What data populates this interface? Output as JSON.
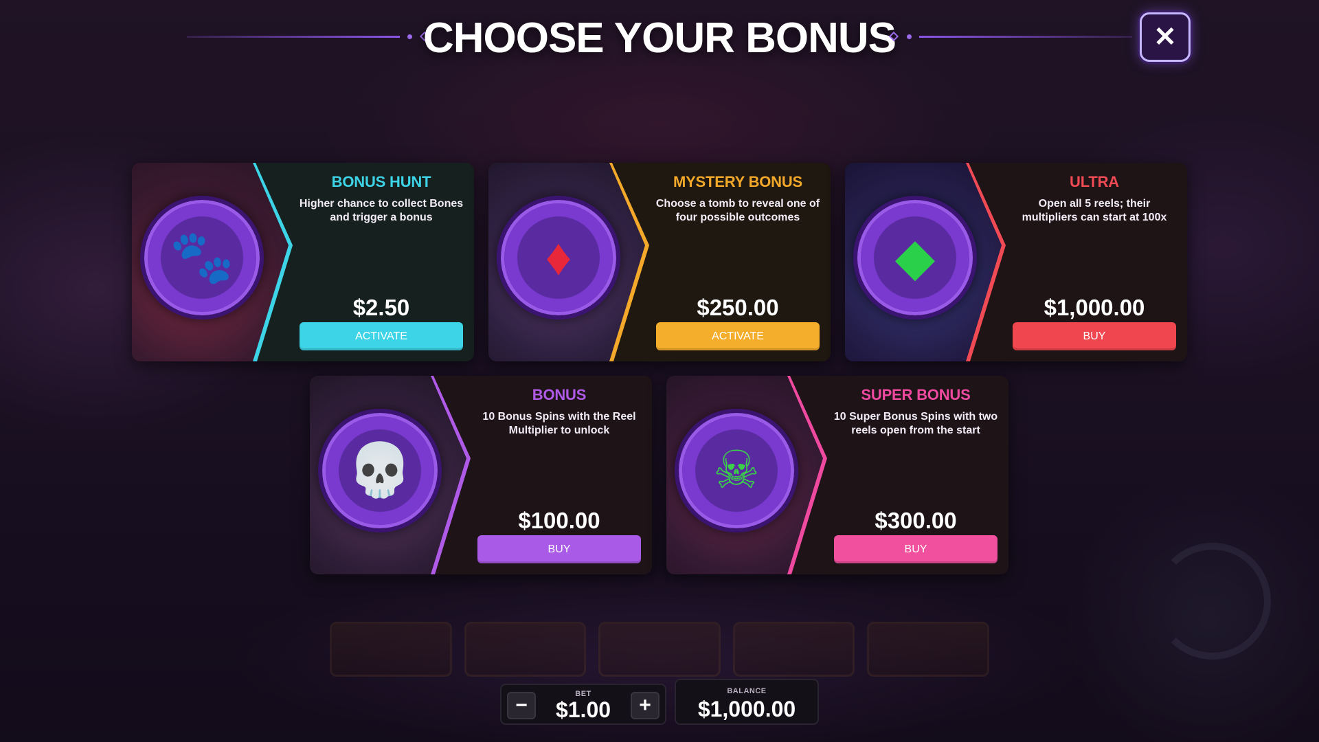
{
  "header": {
    "title": "CHOOSE YOUR BONUS",
    "close_label": "✕"
  },
  "cards": [
    {
      "title": "BONUS HUNT",
      "description": "Higher chance to collect Bones and trigger a bonus",
      "price": "$2.50",
      "button": "ACTIVATE",
      "accent": "#3ed4e8",
      "button_color": "#3ed4e8",
      "icon": "paw-icon"
    },
    {
      "title": "MYSTERY BONUS",
      "description": "Choose a tomb to reveal one of four possible outcomes",
      "price": "$250.00",
      "button": "ACTIVATE",
      "accent": "#f4a92a",
      "button_color": "#f4ae2c",
      "icon": "coffin-gem-icon"
    },
    {
      "title": "ULTRA",
      "description": "Open all 5 reels; their multipliers can start at 100x",
      "price": "$1,000.00",
      "button": "BUY",
      "accent": "#f04a55",
      "button_color": "#ef4650",
      "icon": "green-gem-orb-icon"
    },
    {
      "title": "BONUS",
      "description": "10 Bonus Spins with the Reel Multiplier to unlock",
      "price": "$100.00",
      "button": "BUY",
      "accent": "#b05ae8",
      "button_color": "#a95ae6",
      "icon": "skull-icon"
    },
    {
      "title": "SUPER BONUS",
      "description": "10 Super Bonus Spins with two reels open from the start",
      "price": "$300.00",
      "button": "BUY",
      "accent": "#f04aa0",
      "button_color": "#f0509e",
      "icon": "green-flame-skull-icon"
    }
  ],
  "bet": {
    "label": "BET",
    "value": "$1.00",
    "minus": "−",
    "plus": "+"
  },
  "balance": {
    "label": "BALANCE",
    "value": "$1,000.00"
  }
}
